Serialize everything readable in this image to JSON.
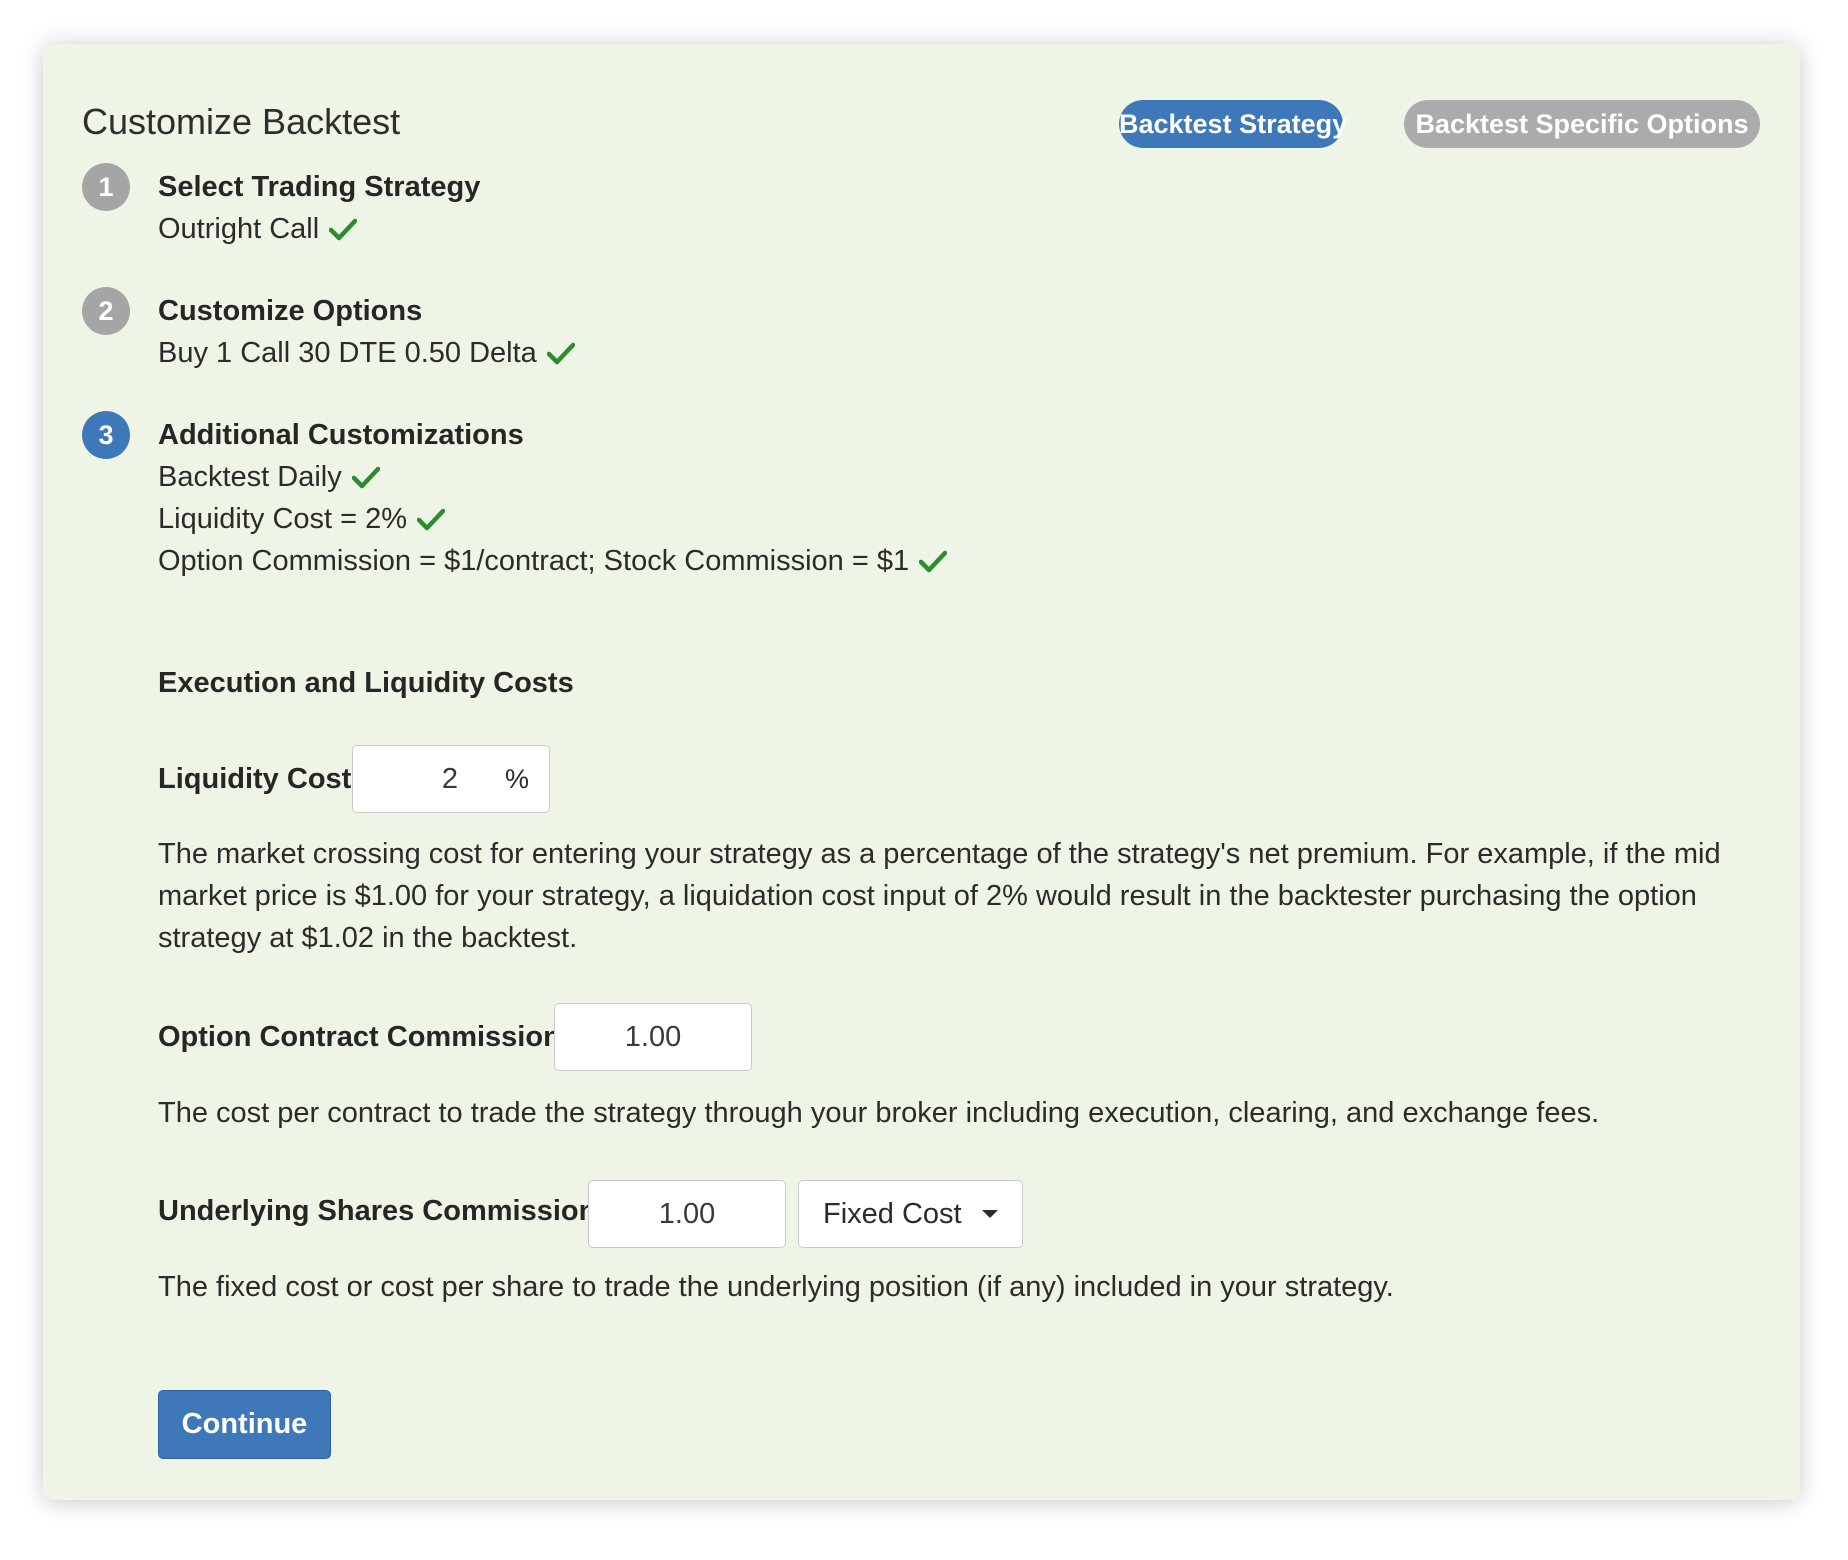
{
  "header": {
    "title": "Customize Backtest",
    "tabs": [
      {
        "label": "Backtest Strategy",
        "active": true
      },
      {
        "label": "Backtest Specific Options",
        "active": false
      }
    ]
  },
  "steps": [
    {
      "number": "1",
      "title": "Select Trading Strategy",
      "lines": [
        "Outright Call"
      ],
      "active": false
    },
    {
      "number": "2",
      "title": "Customize Options",
      "lines": [
        "Buy 1 Call 30 DTE 0.50 Delta"
      ],
      "active": false
    },
    {
      "number": "3",
      "title": "Additional Customizations",
      "lines": [
        "Backtest Daily",
        "Liquidity Cost = 2%",
        "Option Commission = $1/contract; Stock Commission = $1"
      ],
      "active": true
    }
  ],
  "execution": {
    "heading": "Execution and Liquidity Costs",
    "liquidity": {
      "label": "Liquidity Cost",
      "value": "2",
      "suffix": "%",
      "description": "The market crossing cost for entering your strategy as a percentage of the strategy's net premium. For example, if the mid market price is $1.00 for your strategy, a liquidation cost input of 2% would result in the backtester purchasing the option strategy at $1.02 in the backtest."
    },
    "option_commission": {
      "label": "Option Contract Commission",
      "value": "1.00",
      "description": "The cost per contract to trade the strategy through your broker including execution, clearing, and exchange fees."
    },
    "shares_commission": {
      "label": "Underlying Shares Commission",
      "value": "1.00",
      "mode": "Fixed Cost",
      "description": "The fixed cost or cost per share to trade the underlying position (if any) included in your strategy."
    }
  },
  "continue_label": "Continue",
  "icons": {
    "check": "check-icon",
    "caret": "caret-down-icon"
  },
  "colors": {
    "card_bg": "#eef5e7",
    "accent": "#3f78b8",
    "inactive_pill": "#ababab",
    "check": "#2e8b2e"
  }
}
